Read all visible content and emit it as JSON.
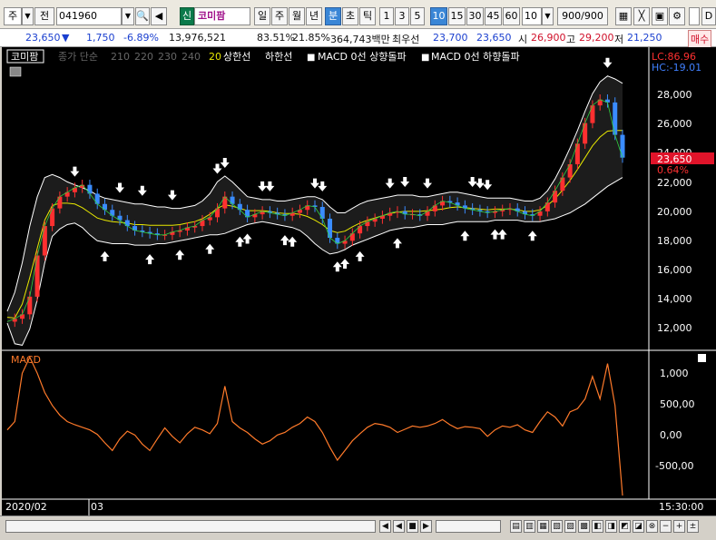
{
  "toolbar": {
    "type_select": "주",
    "prev_label": "전",
    "code": "041960",
    "market_badge": "신",
    "stock_name": "코미팜",
    "periods": [
      "일",
      "주",
      "월",
      "년",
      "분",
      "초",
      "틱"
    ],
    "selected_period": "분",
    "intervals": [
      "1",
      "3",
      "5",
      "10",
      "15",
      "30",
      "45",
      "60"
    ],
    "selected_interval": "10",
    "count_value": "10",
    "display_count": "900/900",
    "menu_d": "D"
  },
  "quote": {
    "price": "23,650",
    "change": "1,750",
    "change_pct": "-6.89%",
    "volume": "13,976,521",
    "ratio1": "83.51%",
    "ratio2": "21.85%",
    "amount": "364,743백만",
    "best_label": "최우선",
    "best_ask": "23,700",
    "best_bid": "23,650",
    "open_label": "시",
    "open": "26,900",
    "high_label": "고",
    "high": "29,200",
    "low_label": "저",
    "low": "21,250",
    "order_btn": "매수"
  },
  "legend": {
    "name": "코미팜",
    "items": [
      "종가 단순",
      "210",
      "220",
      "230",
      "240"
    ],
    "item_20": "20",
    "upper": "상한선",
    "lower": "하한선",
    "macd_up": "MACD 0선 상향돌파",
    "macd_down": "MACD 0선 하향돌파",
    "lc": "LC:86.96",
    "hc": "HC:-19.01"
  },
  "price_axis": {
    "ticks": [
      "28,000",
      "26,000",
      "24,000",
      "22,000",
      "20,000",
      "18,000",
      "16,000",
      "14,000",
      "12,000"
    ],
    "current_price": "23,650",
    "current_pct": "0.64%"
  },
  "macd_panel": {
    "title": "MACD",
    "ticks": [
      "1,000",
      "500,00",
      "0,00",
      "-500,00"
    ]
  },
  "time_axis": {
    "left_label": "2020/02",
    "mid_label": "03",
    "right_label": "15:30:00"
  },
  "chart_data": {
    "type": "line",
    "price_ylim": [
      10800,
      29800
    ],
    "macd_ylim": [
      -1000,
      1200
    ],
    "price_series": {
      "name": "종가",
      "values": [
        12500,
        12700,
        13000,
        14200,
        17000,
        19000,
        20200,
        21000,
        21300,
        21600,
        21800,
        21200,
        20500,
        20100,
        19700,
        19400,
        19000,
        18700,
        18600,
        18500,
        18400,
        18400,
        18600,
        18700,
        18900,
        19000,
        19400,
        19600,
        20200,
        21000,
        20500,
        20100,
        19600,
        19800,
        20000,
        19900,
        19800,
        19700,
        19900,
        20100,
        20400,
        20300,
        19500,
        18200,
        17800,
        18000,
        18500,
        19000,
        19300,
        19500,
        19700,
        19900,
        20000,
        19800,
        19800,
        19700,
        20000,
        20400,
        20700,
        20600,
        20400,
        20200,
        20100,
        20000,
        19900,
        20000,
        20100,
        20200,
        20000,
        19800,
        19700,
        20000,
        20600,
        21400,
        22300,
        23200,
        24600,
        26000,
        27200,
        27600,
        27400,
        25200,
        23650
      ]
    },
    "upper_band": [
      13200,
      14500,
      16500,
      19000,
      21000,
      22300,
      22500,
      22300,
      22000,
      21800,
      21600,
      21400,
      21100,
      20900,
      20800,
      20700,
      20600,
      20500,
      20500,
      20400,
      20300,
      20300,
      20200,
      20200,
      20300,
      20400,
      20700,
      21200,
      22000,
      22400,
      22000,
      21500,
      21000,
      20900,
      20800,
      20800,
      20700,
      20700,
      20800,
      20900,
      21000,
      21000,
      20800,
      20300,
      19900,
      19900,
      20200,
      20500,
      20700,
      20800,
      20900,
      21000,
      21100,
      21100,
      21100,
      21000,
      21000,
      21100,
      21200,
      21300,
      21300,
      21200,
      21100,
      21000,
      20900,
      20900,
      20900,
      20900,
      20800,
      20700,
      20700,
      20900,
      21400,
      22200,
      23200,
      24300,
      25500,
      26800,
      28000,
      28800,
      29200,
      29000,
      28700
    ],
    "lower_band": [
      12400,
      11000,
      10900,
      12000,
      14000,
      16500,
      18300,
      18800,
      19100,
      19200,
      18900,
      18400,
      18000,
      17900,
      17800,
      17800,
      17800,
      17700,
      17700,
      17700,
      17800,
      17800,
      17900,
      18000,
      18100,
      18200,
      18300,
      18400,
      18400,
      18500,
      18700,
      18900,
      19100,
      19200,
      19300,
      19200,
      19100,
      19000,
      18900,
      18700,
      18300,
      17800,
      17400,
      17100,
      17200,
      17400,
      17700,
      17900,
      18100,
      18300,
      18500,
      18700,
      18800,
      18900,
      18900,
      19000,
      19100,
      19100,
      19100,
      19200,
      19300,
      19300,
      19300,
      19300,
      19300,
      19400,
      19400,
      19400,
      19400,
      19300,
      19300,
      19300,
      19400,
      19500,
      19700,
      19900,
      20200,
      20500,
      20900,
      21300,
      21700,
      22000,
      22300
    ],
    "macd_series": {
      "name": "MACD",
      "values": [
        20,
        150,
        900,
        1150,
        900,
        600,
        400,
        250,
        150,
        100,
        60,
        20,
        -50,
        -180,
        -300,
        -120,
        0,
        -60,
        -200,
        -300,
        -120,
        50,
        -80,
        -180,
        -40,
        60,
        20,
        -40,
        120,
        700,
        150,
        50,
        -20,
        -120,
        -200,
        -150,
        -60,
        -20,
        60,
        120,
        220,
        150,
        -20,
        -250,
        -450,
        -300,
        -150,
        -40,
        60,
        120,
        100,
        60,
        -20,
        30,
        80,
        60,
        80,
        120,
        180,
        100,
        40,
        70,
        60,
        40,
        -80,
        20,
        80,
        60,
        100,
        20,
        -20,
        150,
        300,
        220,
        80,
        300,
        350,
        500,
        850,
        500,
        1050,
        400,
        -1000
      ]
    },
    "buy_signals": [
      13,
      19,
      23,
      27,
      31,
      32,
      37,
      38,
      44,
      45,
      47,
      52,
      61,
      65,
      66,
      70
    ],
    "sell_signals": [
      9,
      15,
      18,
      22,
      28,
      29,
      34,
      35,
      41,
      42,
      51,
      53,
      56,
      62,
      63,
      64,
      80
    ]
  }
}
